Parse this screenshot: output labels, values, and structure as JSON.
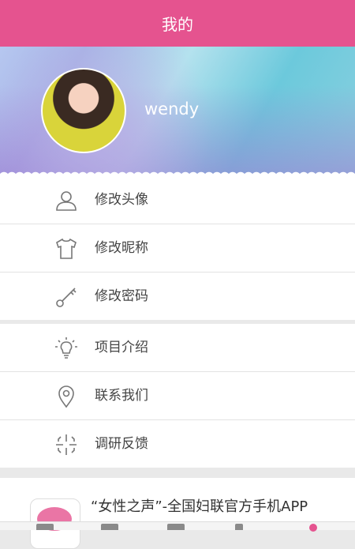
{
  "header": {
    "title": "我的"
  },
  "profile": {
    "username": "wendy"
  },
  "menu_group_1": [
    {
      "label": "修改头像",
      "icon": "user-icon"
    },
    {
      "label": "修改昵称",
      "icon": "tshirt-icon"
    },
    {
      "label": "修改密码",
      "icon": "key-icon"
    }
  ],
  "menu_group_2": [
    {
      "label": "项目介绍",
      "icon": "lightbulb-icon"
    },
    {
      "label": "联系我们",
      "icon": "location-pin-icon"
    },
    {
      "label": "调研反馈",
      "icon": "crosshair-icon"
    }
  ],
  "promo": {
    "text": "“女性之声”-全国妇联官方手机APP"
  },
  "colors": {
    "accent": "#e5538f",
    "icon": "#777777",
    "text": "#444444"
  }
}
